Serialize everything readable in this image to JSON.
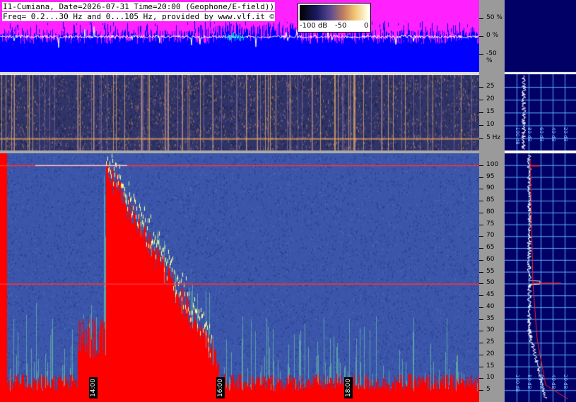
{
  "header": {
    "line1": "I1-Cumiana, Date=2026-07-31 Time=20:00 (Geophone/E-field))",
    "line2": "Freq= 0.2...30 Hz and 0...105 Hz, provided by www.vlf.it ©"
  },
  "colorbar": {
    "labels": [
      "-100 dB",
      "-50",
      "0"
    ],
    "min_db": -100,
    "max_db": 0
  },
  "colors": {
    "top_bg": "#ff22ff",
    "top_signal": "#0000ff",
    "spectro_hot": "#ff0000",
    "spectro_mid": "#ffff99",
    "spectro_low": "#3a55aa",
    "axis_bg": "#9a9a9a",
    "right_bg": "#000066",
    "grid": "#5fb3ff"
  },
  "chart_data": [
    {
      "type": "line",
      "title": "",
      "ylabel": "",
      "yticks": [
        "50 %",
        "0 %",
        "-50 %"
      ],
      "ylim": [
        -100,
        100
      ]
    },
    {
      "type": "heatmap",
      "title": "",
      "ylabel": "Hz",
      "yticks": [
        "25",
        "20",
        "15",
        "10",
        "5 Hz"
      ],
      "ylim": [
        0.2,
        30
      ]
    },
    {
      "type": "heatmap",
      "title": "",
      "yticks": [
        "100",
        "95",
        "90",
        "85",
        "80",
        "75",
        "70",
        "65",
        "60",
        "55",
        "50",
        "45",
        "40",
        "35",
        "30",
        "25",
        "20",
        "15",
        "10",
        "5"
      ],
      "ylim": [
        0,
        105
      ],
      "xticks": [
        "14:00",
        "16:00",
        "18:00"
      ]
    },
    {
      "type": "line",
      "title": "",
      "xticks": [
        "100 dB",
        "80 dB",
        "60 dB",
        "40 dB",
        "20 dB"
      ],
      "xticks_top": [
        "100 dB",
        "80 dB",
        "60 dB",
        "40 dB",
        "20 dB"
      ]
    }
  ]
}
